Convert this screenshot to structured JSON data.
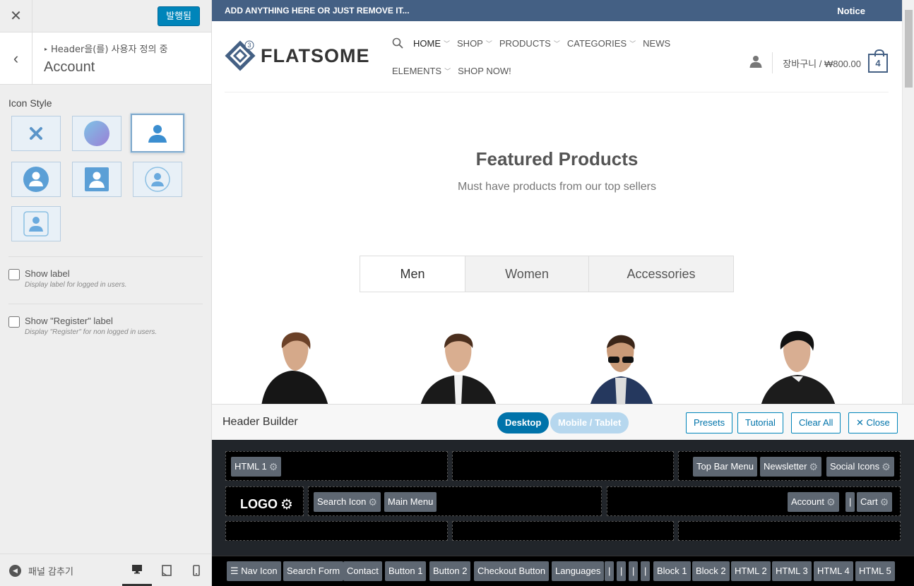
{
  "panel": {
    "close_glyph": "✕",
    "publish_label": "발행됨",
    "back_glyph": "‹",
    "breadcrumb": "Header을(를) 사용자 정의 중",
    "section_title": "Account",
    "icon_style_label": "Icon Style",
    "icon_options": [
      "none",
      "image-circle",
      "plain",
      "circle-fill",
      "square-fill",
      "circle-outline",
      "square-outline"
    ],
    "selected_icon": "plain",
    "show_label": "Show label",
    "show_label_desc": "Display label for logged in users.",
    "show_register": "Show \"Register\" label",
    "show_register_desc": "Display \"Register\" for non logged in users.",
    "collapse_label": "패널 감추기",
    "devices": [
      "desktop",
      "tablet",
      "mobile"
    ]
  },
  "site": {
    "topbar_text": "ADD ANYTHING HERE OR JUST REMOVE IT...",
    "topbar_notice": "Notice",
    "logo_text": "FLATSOME",
    "logo_badge": "3",
    "nav_row1": [
      "HOME",
      "SHOP",
      "PRODUCTS",
      "CATEGORIES",
      "NEWS"
    ],
    "nav_row2": [
      "ELEMENTS",
      "SHOP NOW!"
    ],
    "cart_text": "장바구니 / ₩800.00",
    "cart_count": "4",
    "featured_title": "Featured Products",
    "featured_sub": "Must have products from our top sellers",
    "tabs": [
      "Men",
      "Women",
      "Accessories"
    ]
  },
  "builder": {
    "title": "Header Builder",
    "desktop_label": "Desktop",
    "mobile_label": "Mobile / Tablet",
    "presets_label": "Presets",
    "tutorial_label": "Tutorial",
    "clear_label": "Clear All",
    "close_label": "✕ Close",
    "top_left": [
      "HTML 1"
    ],
    "top_right": [
      "Top Bar Menu",
      "Newsletter",
      "Social Icons"
    ],
    "main_logo": "LOGO",
    "main_center": [
      "Search Icon",
      "Main Menu"
    ],
    "main_right": [
      "Account",
      "|",
      "Cart"
    ],
    "available": [
      "☰ Nav Icon",
      "Search Form",
      "Contact",
      "Button 1",
      "Button 2",
      "Checkout Button",
      "Languages",
      "|",
      "|",
      "|",
      "|",
      "Block 1",
      "Block 2",
      "HTML 2",
      "HTML 3",
      "HTML 4",
      "HTML 5"
    ]
  },
  "colors": {
    "primary": "#446084",
    "wp_blue": "#0085ba",
    "icon_blue": "#3b8ed0"
  }
}
